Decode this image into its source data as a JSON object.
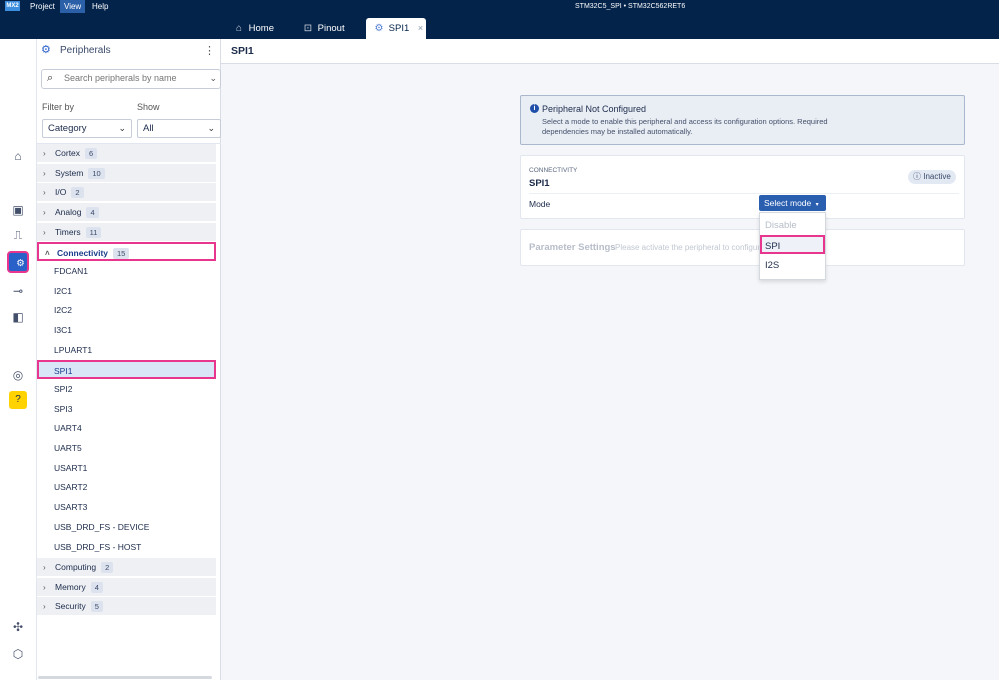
{
  "topbar": {
    "logo": "MX2",
    "menus": [
      "Project",
      "View",
      "Help"
    ],
    "active_menu": "View",
    "window_title": "STM32C5_SPI  •  STM32C562RET6"
  },
  "tabs": [
    {
      "label": "Home",
      "icon": "home-icon"
    },
    {
      "label": "Pinout",
      "icon": "chip-icon"
    },
    {
      "label": "SPI1",
      "icon": "peripherals-icon",
      "close": "×"
    }
  ],
  "rail_icons": [
    "home-icon",
    "chip-icon",
    "clock-signal-icon",
    "peripherals-icon",
    "pin-icon",
    "board-icon",
    "gear-target-icon",
    "help-icon",
    "puzzle-icon",
    "settings-icon"
  ],
  "panel": {
    "title": "Peripherals",
    "kebab": "⋮",
    "search_placeholder": "Search peripherals by name",
    "filter_by_label": "Filter by",
    "show_label": "Show",
    "filter_value": "Category",
    "show_value": "All",
    "categories_before": [
      {
        "name": "Cortex",
        "count": "6"
      },
      {
        "name": "System",
        "count": "10"
      },
      {
        "name": "I/O",
        "count": "2"
      },
      {
        "name": "Analog",
        "count": "4"
      },
      {
        "name": "Timers",
        "count": "11"
      }
    ],
    "open_category": {
      "name": "Connectivity",
      "count": "15"
    },
    "items": [
      "FDCAN1",
      "I2C1",
      "I2C2",
      "I3C1",
      "LPUART1",
      "SPI1",
      "SPI2",
      "SPI3",
      "UART4",
      "UART5",
      "USART1",
      "USART2",
      "USART3",
      "USB_DRD_FS - DEVICE",
      "USB_DRD_FS - HOST"
    ],
    "selected_item": "SPI1",
    "categories_after": [
      {
        "name": "Computing",
        "count": "2"
      },
      {
        "name": "Memory",
        "count": "4"
      },
      {
        "name": "Security",
        "count": "5"
      }
    ]
  },
  "main": {
    "title": "SPI1",
    "info": {
      "title": "Peripheral Not Configured",
      "desc": "Select a mode to enable this peripheral and access its configuration options. Required dependencies may be installed automatically."
    },
    "card": {
      "category": "CONNECTIVITY",
      "name": "SPI1",
      "status": "Inactive",
      "mode_label": "Mode",
      "mode_button": "Select mode"
    },
    "params": {
      "title": "Parameter Settings",
      "subtitle": "Please activate the peripheral to configure"
    },
    "mode_options": [
      {
        "label": "Disable",
        "state": "disabled"
      },
      {
        "label": "SPI",
        "state": "highlighted"
      },
      {
        "label": "I2S",
        "state": "normal"
      }
    ]
  }
}
